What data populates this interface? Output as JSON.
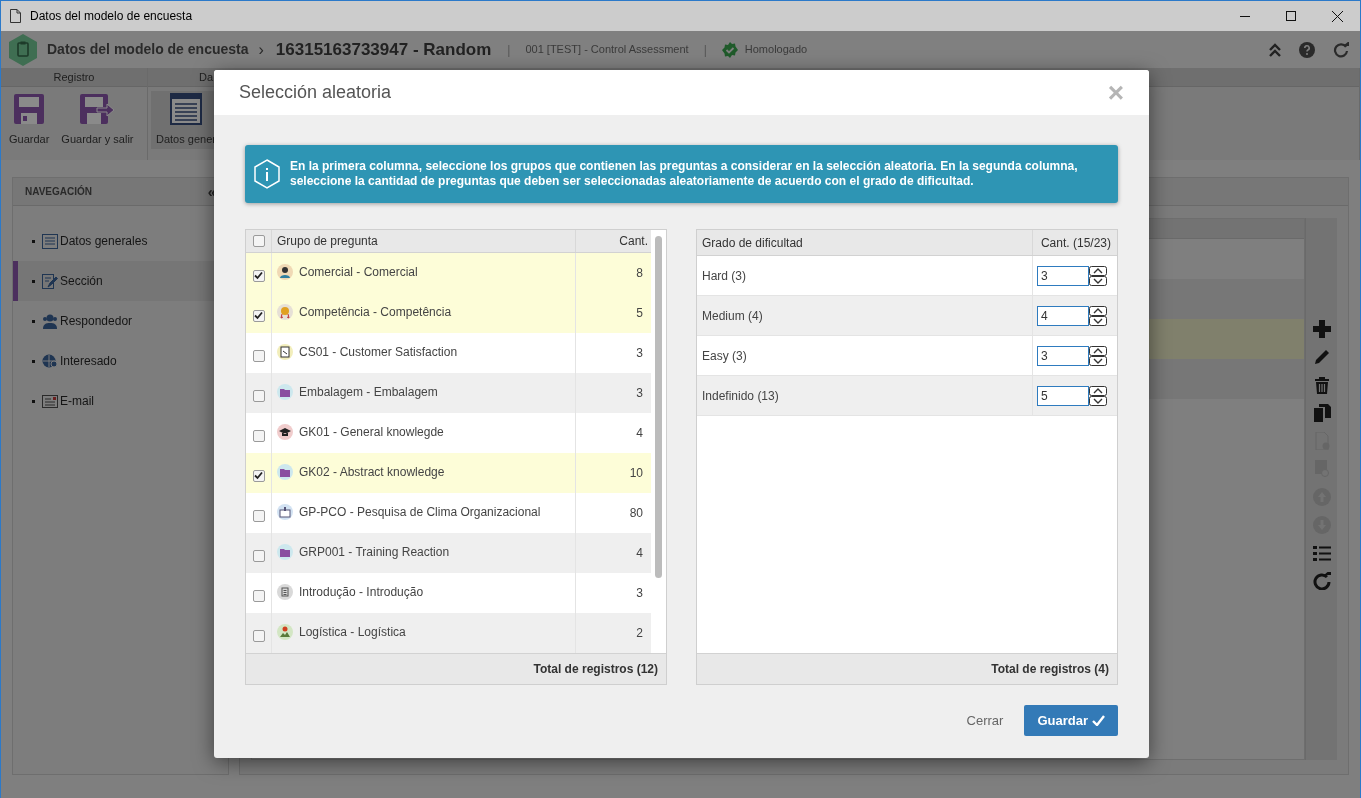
{
  "window": {
    "title": "Datos del modelo de encuesta"
  },
  "header": {
    "breadcrumb": "Datos del modelo de encuesta",
    "separator": "›",
    "record": "16315163733947 - Random",
    "divider": "|",
    "form": "001 [TEST] - Control Assessment",
    "status": "Homologado"
  },
  "ribbon": {
    "groups": [
      {
        "label": "Registro",
        "buttons": [
          {
            "label": "Guardar",
            "kind": "save"
          },
          {
            "label": "Guardar y salir",
            "kind": "save-exit"
          }
        ]
      },
      {
        "label": "Da",
        "buttons": [
          {
            "label": "Datos gener",
            "kind": "form"
          }
        ]
      }
    ]
  },
  "navigation": {
    "title": "NAVEGACIÓN",
    "collapse": "«",
    "items": [
      {
        "label": "Datos generales",
        "selected": false
      },
      {
        "label": "Sección",
        "selected": true
      },
      {
        "label": "Respondedor",
        "selected": false
      },
      {
        "label": "Interesado",
        "selected": false
      },
      {
        "label": "E-mail",
        "selected": false
      }
    ]
  },
  "toolbar": [
    {
      "kind": "add",
      "disabled": false
    },
    {
      "kind": "edit",
      "disabled": false
    },
    {
      "kind": "delete",
      "disabled": false
    },
    {
      "kind": "copy",
      "disabled": false
    },
    {
      "kind": "info",
      "disabled": true
    },
    {
      "kind": "preview",
      "disabled": true
    },
    {
      "kind": "up",
      "disabled": true
    },
    {
      "kind": "down",
      "disabled": true
    },
    {
      "kind": "list",
      "disabled": false
    },
    {
      "kind": "refresh",
      "disabled": false
    }
  ],
  "dialog": {
    "title": "Selección aleatoria",
    "close": "×",
    "info": "En la primera columna, seleccione los grupos que contienen las preguntas a considerar en la selección aleatoria. En la segunda columna, seleccione la cantidad de preguntas que deben ser seleccionadas aleatoriamente de acuerdo con el grado de dificultad.",
    "groups_table": {
      "all_checked": false,
      "columns": [
        "Grupo de pregunta",
        "Cant."
      ],
      "rows": [
        {
          "name": "Comercial - Comercial",
          "count": "8",
          "checked": true
        },
        {
          "name": "Competência - Competência",
          "count": "5",
          "checked": true
        },
        {
          "name": "CS01 - Customer Satisfaction",
          "count": "3",
          "checked": false
        },
        {
          "name": "Embalagem - Embalagem",
          "count": "3",
          "checked": false
        },
        {
          "name": "GK01 - General knowlegde",
          "count": "4",
          "checked": false
        },
        {
          "name": "GK02 - Abstract knowledge",
          "count": "10",
          "checked": true
        },
        {
          "name": "GP-PCO - Pesquisa de Clima Organizacional",
          "count": "80",
          "checked": false
        },
        {
          "name": "GRP001 - Training Reaction",
          "count": "4",
          "checked": false
        },
        {
          "name": "Introdução - Introdução",
          "count": "3",
          "checked": false
        },
        {
          "name": "Logística - Logística",
          "count": "2",
          "checked": false
        }
      ],
      "footer": "Total de registros (12)"
    },
    "difficulty_table": {
      "columns": [
        "Grado de dificultad",
        "Cant. (15/23)"
      ],
      "rows": [
        {
          "name": "Hard (3)",
          "value": "3"
        },
        {
          "name": "Medium (4)",
          "value": "4"
        },
        {
          "name": "Easy (3)",
          "value": "3"
        },
        {
          "name": "Indefinido (13)",
          "value": "5"
        }
      ],
      "footer": "Total de registros (4)"
    },
    "buttons": {
      "cancel": "Cerrar",
      "save": "Guardar"
    }
  }
}
